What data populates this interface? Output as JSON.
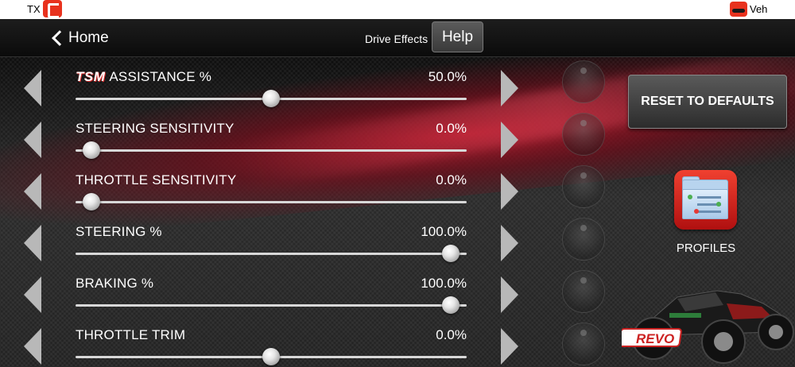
{
  "status_bar": {
    "tx_label": "TX",
    "tx_icon": "transmitter-icon",
    "veh_label": "Veh",
    "veh_icon": "vehicle-icon"
  },
  "nav": {
    "back_label": "Home",
    "back_icon": "chevron-left-icon",
    "title": "Drive Effects",
    "help_label": "Help"
  },
  "settings": [
    {
      "logo": "TSM",
      "label": "ASSISTANCE %",
      "value": "50.0%",
      "level": 0.5
    },
    {
      "label": "STEERING SENSITIVITY",
      "value": "0.0%",
      "level": 0.0
    },
    {
      "label": "THROTTLE SENSITIVITY",
      "value": "0.0%",
      "level": 0.0
    },
    {
      "label": "STEERING %",
      "value": "100.0%",
      "level": 1.0
    },
    {
      "label": "BRAKING %",
      "value": "100.0%",
      "level": 1.0
    },
    {
      "label": "THROTTLE TRIM",
      "value": "0.0%",
      "level": 0.5
    }
  ],
  "right_panel": {
    "reset_label": "RESET TO DEFAULTS",
    "profiles_label": "PROFILES",
    "profiles_icon": "folder-settings-icon",
    "truck_logo": "REVO"
  },
  "colors": {
    "accent_red": "#e8321e",
    "text": "#ffffff",
    "track": "#d8d8d8"
  }
}
